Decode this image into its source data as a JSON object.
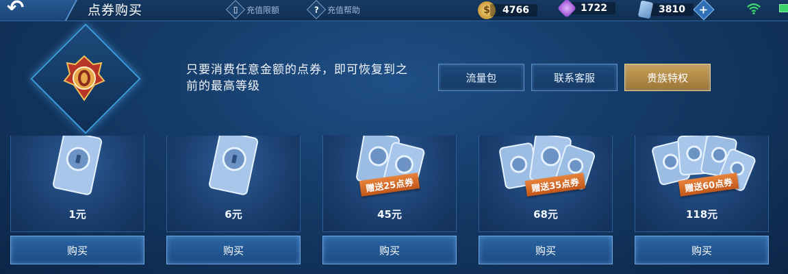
{
  "header": {
    "title": "点券购买",
    "link_limit": "充值限额",
    "link_help": "充值帮助",
    "currencies": [
      {
        "name": "gold-coin",
        "value": "4766",
        "color": "#d9a63a"
      },
      {
        "name": "diamond",
        "value": "1722",
        "color": "#b06ee0"
      },
      {
        "name": "voucher",
        "value": "3810",
        "color": "#6aa3e0"
      }
    ]
  },
  "info": {
    "text": "只要消费任意金额的点券，即可恢复到之前的最高等级",
    "tabs": [
      "流量包",
      "联系客服",
      "贵族特权"
    ]
  },
  "products": [
    {
      "price": "1元",
      "bonus": ""
    },
    {
      "price": "6元",
      "bonus": ""
    },
    {
      "price": "45元",
      "bonus": "赠送25点券"
    },
    {
      "price": "68元",
      "bonus": "赠送35点券"
    },
    {
      "price": "118元",
      "bonus": "赠送60点券"
    }
  ],
  "buy_label": "购买"
}
